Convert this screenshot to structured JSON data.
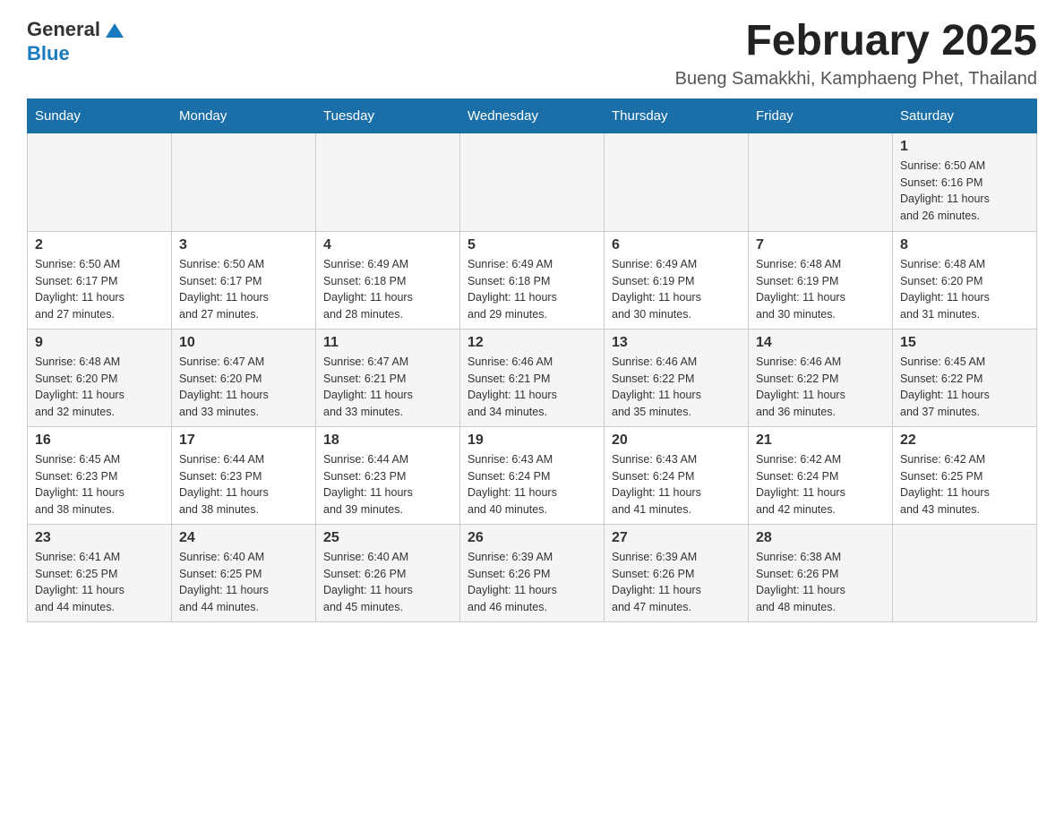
{
  "header": {
    "logo_general": "General",
    "logo_blue": "Blue",
    "month_title": "February 2025",
    "location": "Bueng Samakkhi, Kamphaeng Phet, Thailand"
  },
  "days_of_week": [
    "Sunday",
    "Monday",
    "Tuesday",
    "Wednesday",
    "Thursday",
    "Friday",
    "Saturday"
  ],
  "weeks": [
    {
      "days": [
        {
          "number": "",
          "info": ""
        },
        {
          "number": "",
          "info": ""
        },
        {
          "number": "",
          "info": ""
        },
        {
          "number": "",
          "info": ""
        },
        {
          "number": "",
          "info": ""
        },
        {
          "number": "",
          "info": ""
        },
        {
          "number": "1",
          "info": "Sunrise: 6:50 AM\nSunset: 6:16 PM\nDaylight: 11 hours\nand 26 minutes."
        }
      ]
    },
    {
      "days": [
        {
          "number": "2",
          "info": "Sunrise: 6:50 AM\nSunset: 6:17 PM\nDaylight: 11 hours\nand 27 minutes."
        },
        {
          "number": "3",
          "info": "Sunrise: 6:50 AM\nSunset: 6:17 PM\nDaylight: 11 hours\nand 27 minutes."
        },
        {
          "number": "4",
          "info": "Sunrise: 6:49 AM\nSunset: 6:18 PM\nDaylight: 11 hours\nand 28 minutes."
        },
        {
          "number": "5",
          "info": "Sunrise: 6:49 AM\nSunset: 6:18 PM\nDaylight: 11 hours\nand 29 minutes."
        },
        {
          "number": "6",
          "info": "Sunrise: 6:49 AM\nSunset: 6:19 PM\nDaylight: 11 hours\nand 30 minutes."
        },
        {
          "number": "7",
          "info": "Sunrise: 6:48 AM\nSunset: 6:19 PM\nDaylight: 11 hours\nand 30 minutes."
        },
        {
          "number": "8",
          "info": "Sunrise: 6:48 AM\nSunset: 6:20 PM\nDaylight: 11 hours\nand 31 minutes."
        }
      ]
    },
    {
      "days": [
        {
          "number": "9",
          "info": "Sunrise: 6:48 AM\nSunset: 6:20 PM\nDaylight: 11 hours\nand 32 minutes."
        },
        {
          "number": "10",
          "info": "Sunrise: 6:47 AM\nSunset: 6:20 PM\nDaylight: 11 hours\nand 33 minutes."
        },
        {
          "number": "11",
          "info": "Sunrise: 6:47 AM\nSunset: 6:21 PM\nDaylight: 11 hours\nand 33 minutes."
        },
        {
          "number": "12",
          "info": "Sunrise: 6:46 AM\nSunset: 6:21 PM\nDaylight: 11 hours\nand 34 minutes."
        },
        {
          "number": "13",
          "info": "Sunrise: 6:46 AM\nSunset: 6:22 PM\nDaylight: 11 hours\nand 35 minutes."
        },
        {
          "number": "14",
          "info": "Sunrise: 6:46 AM\nSunset: 6:22 PM\nDaylight: 11 hours\nand 36 minutes."
        },
        {
          "number": "15",
          "info": "Sunrise: 6:45 AM\nSunset: 6:22 PM\nDaylight: 11 hours\nand 37 minutes."
        }
      ]
    },
    {
      "days": [
        {
          "number": "16",
          "info": "Sunrise: 6:45 AM\nSunset: 6:23 PM\nDaylight: 11 hours\nand 38 minutes."
        },
        {
          "number": "17",
          "info": "Sunrise: 6:44 AM\nSunset: 6:23 PM\nDaylight: 11 hours\nand 38 minutes."
        },
        {
          "number": "18",
          "info": "Sunrise: 6:44 AM\nSunset: 6:23 PM\nDaylight: 11 hours\nand 39 minutes."
        },
        {
          "number": "19",
          "info": "Sunrise: 6:43 AM\nSunset: 6:24 PM\nDaylight: 11 hours\nand 40 minutes."
        },
        {
          "number": "20",
          "info": "Sunrise: 6:43 AM\nSunset: 6:24 PM\nDaylight: 11 hours\nand 41 minutes."
        },
        {
          "number": "21",
          "info": "Sunrise: 6:42 AM\nSunset: 6:24 PM\nDaylight: 11 hours\nand 42 minutes."
        },
        {
          "number": "22",
          "info": "Sunrise: 6:42 AM\nSunset: 6:25 PM\nDaylight: 11 hours\nand 43 minutes."
        }
      ]
    },
    {
      "days": [
        {
          "number": "23",
          "info": "Sunrise: 6:41 AM\nSunset: 6:25 PM\nDaylight: 11 hours\nand 44 minutes."
        },
        {
          "number": "24",
          "info": "Sunrise: 6:40 AM\nSunset: 6:25 PM\nDaylight: 11 hours\nand 44 minutes."
        },
        {
          "number": "25",
          "info": "Sunrise: 6:40 AM\nSunset: 6:26 PM\nDaylight: 11 hours\nand 45 minutes."
        },
        {
          "number": "26",
          "info": "Sunrise: 6:39 AM\nSunset: 6:26 PM\nDaylight: 11 hours\nand 46 minutes."
        },
        {
          "number": "27",
          "info": "Sunrise: 6:39 AM\nSunset: 6:26 PM\nDaylight: 11 hours\nand 47 minutes."
        },
        {
          "number": "28",
          "info": "Sunrise: 6:38 AM\nSunset: 6:26 PM\nDaylight: 11 hours\nand 48 minutes."
        },
        {
          "number": "",
          "info": ""
        }
      ]
    }
  ]
}
